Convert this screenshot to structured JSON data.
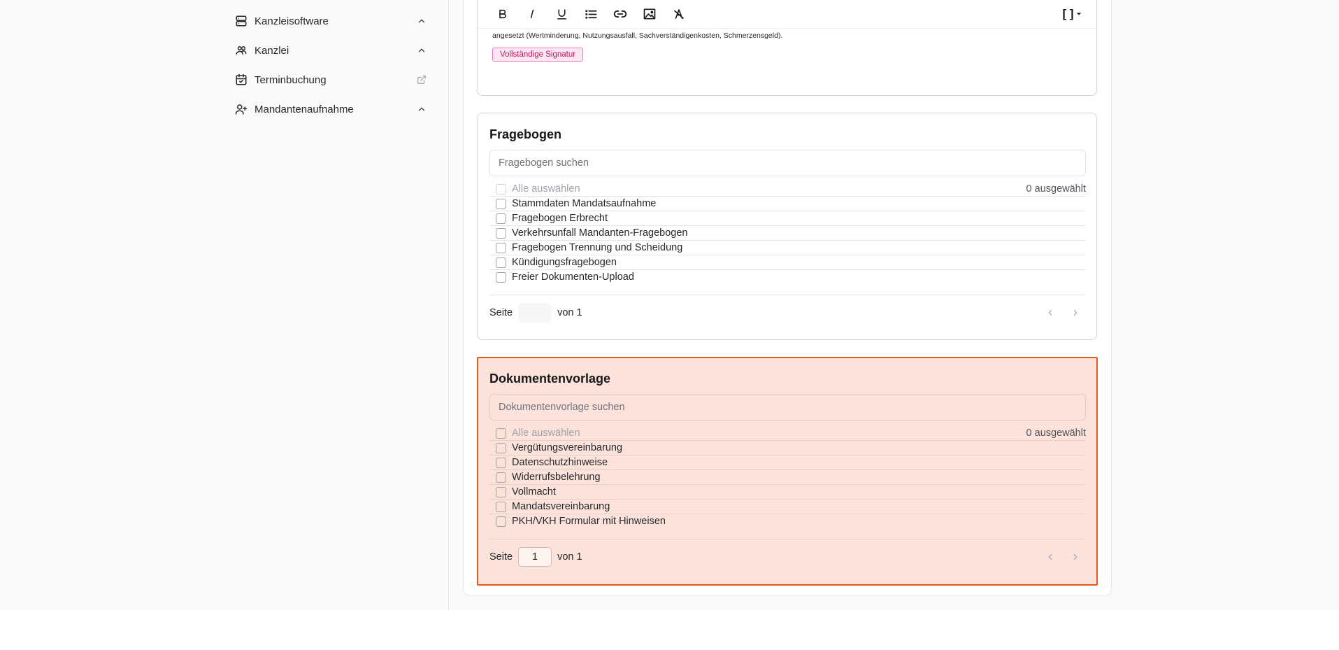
{
  "sidebar": {
    "items": [
      {
        "label": "Kanzleisoftware",
        "icon": "server-icon",
        "trailing": "chevron-up-icon"
      },
      {
        "label": "Kanzlei",
        "icon": "users-icon",
        "trailing": "chevron-up-icon"
      },
      {
        "label": "Terminbuchung",
        "icon": "calendar-check-icon",
        "trailing": "external-link-icon"
      },
      {
        "label": "Mandantenaufnahme",
        "icon": "user-plus-icon",
        "trailing": "chevron-up-icon"
      }
    ]
  },
  "editor": {
    "toolbar": [
      "bold-icon",
      "italic-icon",
      "underline-icon",
      "bullet-list-icon",
      "link-icon",
      "image-icon",
      "clear-format-icon",
      "placeholder-brackets-icon"
    ],
    "text": "angesetzt (Wertminderung, Nutzungsausfall, Sachverständigenkosten, Schmerzensgeld).",
    "signature_badge": "Vollständige Signatur",
    "brackets_label": "[ ]"
  },
  "fragebogen": {
    "title": "Fragebogen",
    "search_placeholder": "Fragebogen suchen",
    "select_all": "Alle auswählen",
    "selected_count": "0 ausgewählt",
    "items": [
      "Stammdaten Mandatsaufnahme",
      "Fragebogen Erbrecht",
      "Verkehrsunfall Mandanten-Fragebogen",
      "Fragebogen Trennung und Scheidung",
      "Kündigungsfragebogen",
      "Freier Dokumenten-Upload"
    ],
    "pager": {
      "page_label": "Seite",
      "of_label": "von 1",
      "page_value": ""
    }
  },
  "dokumentenvorlage": {
    "title": "Dokumentenvorlage",
    "search_placeholder": "Dokumentenvorlage suchen",
    "select_all": "Alle auswählen",
    "selected_count": "0 ausgewählt",
    "items": [
      "Vergütungsvereinbarung",
      "Datenschutzhinweise",
      "Widerrufsbelehrung",
      "Vollmacht",
      "Mandatsvereinbarung",
      "PKH/VKH Formular mit Hinweisen"
    ],
    "pager": {
      "page_label": "Seite",
      "of_label": "von 1",
      "page_value": "1"
    }
  },
  "colors": {
    "highlight_border": "#e45a1c",
    "highlight_bg": "#fbe3dc",
    "badge_text": "#be185d",
    "badge_bg": "#fce7f3"
  }
}
